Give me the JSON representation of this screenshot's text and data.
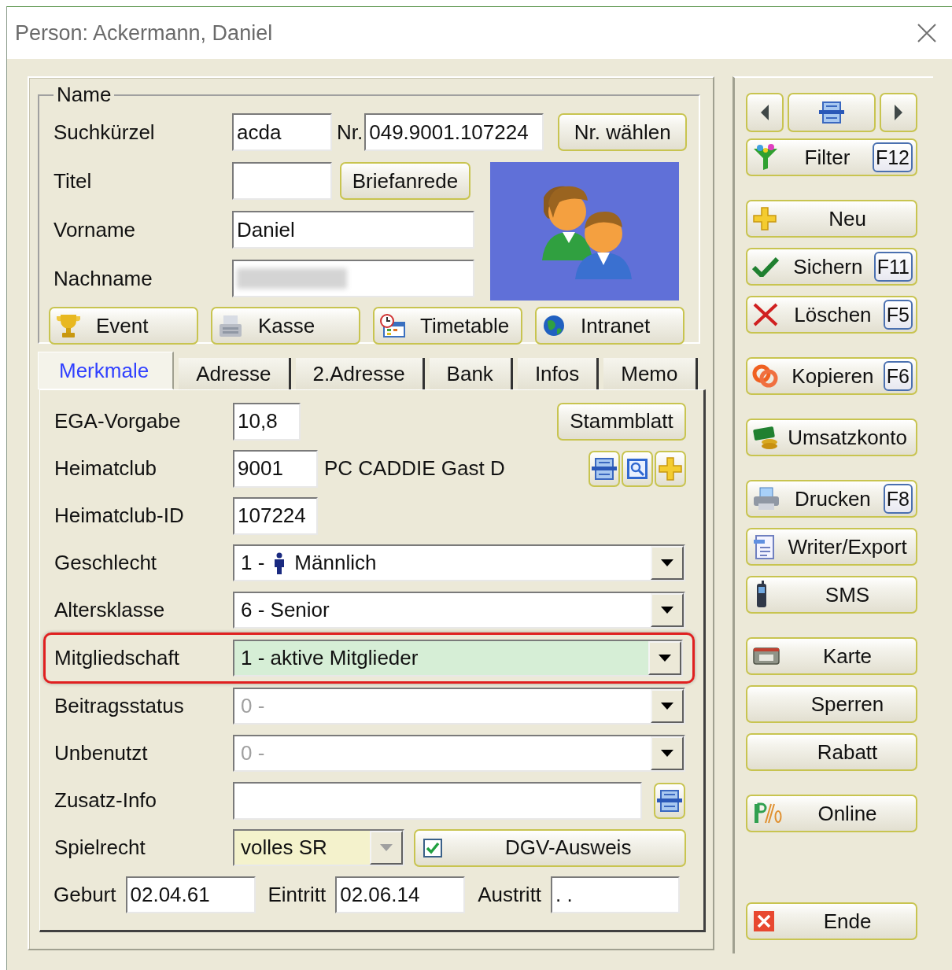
{
  "window": {
    "title": "Person: Ackermann, Daniel"
  },
  "name_group": {
    "legend": "Name",
    "suchkuerzel": {
      "label": "Suchkürzel",
      "value": "acda"
    },
    "nr": {
      "label": "Nr.",
      "value": "049.9001.107224"
    },
    "nr_button": "Nr. wählen",
    "titel": {
      "label": "Titel"
    },
    "briefanrede_button": "Briefanrede",
    "vorname": {
      "label": "Vorname",
      "value": "Daniel"
    },
    "nachname": {
      "label": "Nachname",
      "blurred": true
    },
    "buttons": [
      {
        "label": "Event",
        "kind": "trophy"
      },
      {
        "label": "Kasse",
        "kind": "register"
      },
      {
        "label": "Timetable",
        "kind": "timetable"
      },
      {
        "label": "Intranet",
        "kind": "globe"
      }
    ]
  },
  "tabs": [
    {
      "label": "Merkmale",
      "selected": true
    },
    {
      "label": "Adresse",
      "selected": false
    },
    {
      "label": "2.Adresse",
      "selected": false
    },
    {
      "label": "Bank",
      "selected": false
    },
    {
      "label": "Infos",
      "selected": false
    },
    {
      "label": "Memo",
      "selected": false
    }
  ],
  "rows": [
    {
      "kind": "input-button",
      "label": "EGA-Vorgabe",
      "value": "10,8",
      "button": "Stammblatt"
    },
    {
      "kind": "club",
      "label": "Heimatclub",
      "value": "9001",
      "text": "PC CADDIE Gast D"
    },
    {
      "kind": "input",
      "label": "Heimatclub-ID",
      "value": "107224"
    },
    {
      "kind": "gender-combo",
      "label": "Geschlecht",
      "prefix": "1 -",
      "value": "Männlich",
      "disabled": false,
      "highlighted": false
    },
    {
      "kind": "combo",
      "label": "Altersklasse",
      "value": "6 - Senior",
      "disabled": false,
      "highlighted": false
    },
    {
      "kind": "combo",
      "label": "Mitgliedschaft",
      "value": "1 - aktive Mitglieder",
      "disabled": false,
      "highlighted": true
    },
    {
      "kind": "combo",
      "label": "Beitragsstatus",
      "value": "0 -",
      "disabled": true,
      "highlighted": false
    },
    {
      "kind": "combo",
      "label": "Unbenutzt",
      "value": "0 -",
      "disabled": true,
      "highlighted": false
    },
    {
      "kind": "input-icon",
      "label": "Zusatz-Info"
    },
    {
      "kind": "spielrecht",
      "label": "Spielrecht",
      "value": "volles SR",
      "checkbox": {
        "label": "DGV-Ausweis",
        "checked": true
      }
    },
    {
      "kind": "dates",
      "items": [
        {
          "label": "Geburt",
          "value": "02.04.61"
        },
        {
          "label": "Eintritt",
          "value": "02.06.14"
        },
        {
          "label": "Austritt",
          "value": ". ."
        }
      ]
    }
  ],
  "side_groups": [
    [
      {
        "kind": "nav"
      },
      {
        "kind": "filter",
        "label": "Filter",
        "key": "F12"
      }
    ],
    [
      {
        "kind": "plus",
        "label": "Neu"
      },
      {
        "kind": "check",
        "label": "Sichern",
        "key": "F11"
      },
      {
        "kind": "cross",
        "label": "Löschen",
        "key": "F5"
      }
    ],
    [
      {
        "kind": "copy",
        "label": "Kopieren",
        "key": "F6"
      }
    ],
    [
      {
        "kind": "money",
        "label": "Umsatzkonto"
      }
    ],
    [
      {
        "kind": "printer",
        "label": "Drucken",
        "key": "F8"
      },
      {
        "kind": "document",
        "label": "Writer/Export"
      },
      {
        "kind": "phone",
        "label": "SMS"
      }
    ],
    [
      {
        "kind": "card",
        "label": "Karte"
      },
      {
        "kind": "none",
        "label": "Sperren"
      },
      {
        "kind": "none",
        "label": "Rabatt"
      }
    ],
    [
      {
        "kind": "logo",
        "label": "Online"
      }
    ],
    [
      {
        "kind": "exit",
        "label": "Ende"
      }
    ]
  ]
}
